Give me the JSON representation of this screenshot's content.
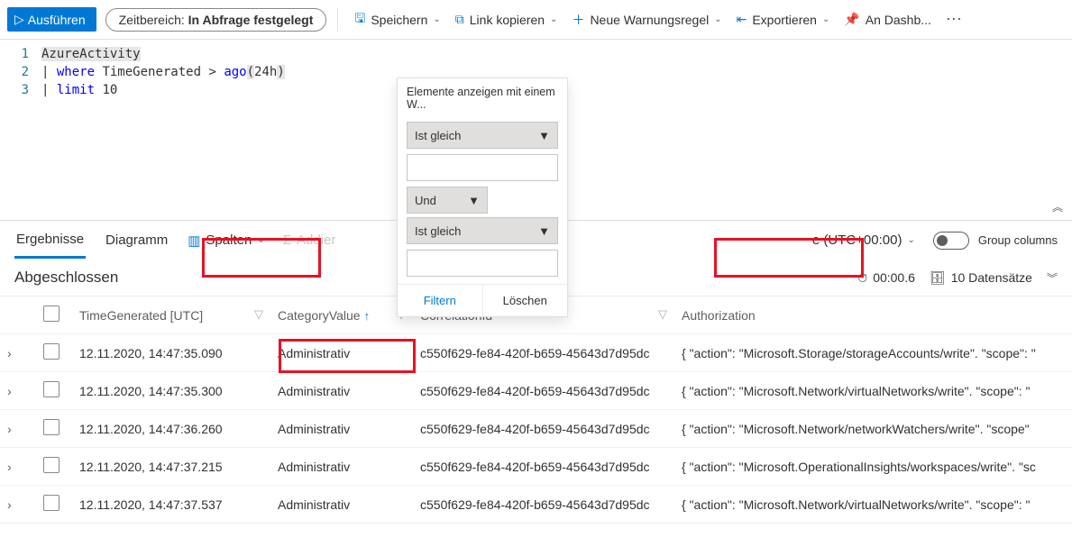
{
  "toolbar": {
    "run": "Ausführen",
    "timerange_prefix": "Zeitbereich: ",
    "timerange_value": "In Abfrage festgelegt",
    "save": "Speichern",
    "copy_link": "Link kopieren",
    "new_alert": "Neue Warnungsregel",
    "export": "Exportieren",
    "dashboard": "An Dashb..."
  },
  "editor": {
    "lines": [
      "1",
      "2",
      "3"
    ],
    "l1": "AzureActivity",
    "l2_kw": "where",
    "l2_rest_a": " TimeGenerated > ",
    "l2_fn": "ago",
    "l2_paren_open": "(",
    "l2_num": "24h",
    "l2_paren_close": ")",
    "l3_kw": "limit",
    "l3_rest": " 10"
  },
  "tabs": {
    "results": "Ergebnisse",
    "chart": "Diagramm",
    "columns": "Spalten",
    "addier": "Addier",
    "tz": "e (UTC+00:00)",
    "group": "Group columns"
  },
  "status": {
    "title": "Abgeschlossen",
    "time": "00:00.6",
    "count": "10 Datensätze"
  },
  "columns": {
    "time": "TimeGenerated [UTC]",
    "category": "CategoryValue",
    "corr": "CorrelationId",
    "auth": "Authorization"
  },
  "popover": {
    "title": "Elemente anzeigen mit einem W...",
    "op1": "Ist gleich",
    "join": "Und",
    "op2": "Ist gleich",
    "filter": "Filtern",
    "clear": "Löschen"
  },
  "rows": [
    {
      "time": "12.11.2020, 14:47:35.090",
      "cat": "Administrativ",
      "corr": "c550f629-fe84-420f-b659-45643d7d95dc",
      "auth": "{ \"action\": \"Microsoft.Storage/storageAccounts/write\". \"scope\": \""
    },
    {
      "time": "12.11.2020, 14:47:35.300",
      "cat": "Administrativ",
      "corr": "c550f629-fe84-420f-b659-45643d7d95dc",
      "auth": "{ \"action\": \"Microsoft.Network/virtualNetworks/write\". \"scope\": \""
    },
    {
      "time": "12.11.2020, 14:47:36.260",
      "cat": "Administrativ",
      "corr": "c550f629-fe84-420f-b659-45643d7d95dc",
      "auth": "{ \"action\": \"Microsoft.Network/networkWatchers/write\". \"scope\""
    },
    {
      "time": "12.11.2020, 14:47:37.215",
      "cat": "Administrativ",
      "corr": "c550f629-fe84-420f-b659-45643d7d95dc",
      "auth": "{ \"action\": \"Microsoft.OperationalInsights/workspaces/write\". \"sc"
    },
    {
      "time": "12.11.2020, 14:47:37.537",
      "cat": "Administrativ",
      "corr": "c550f629-fe84-420f-b659-45643d7d95dc",
      "auth": "{ \"action\": \"Microsoft.Network/virtualNetworks/write\". \"scope\": \""
    }
  ]
}
